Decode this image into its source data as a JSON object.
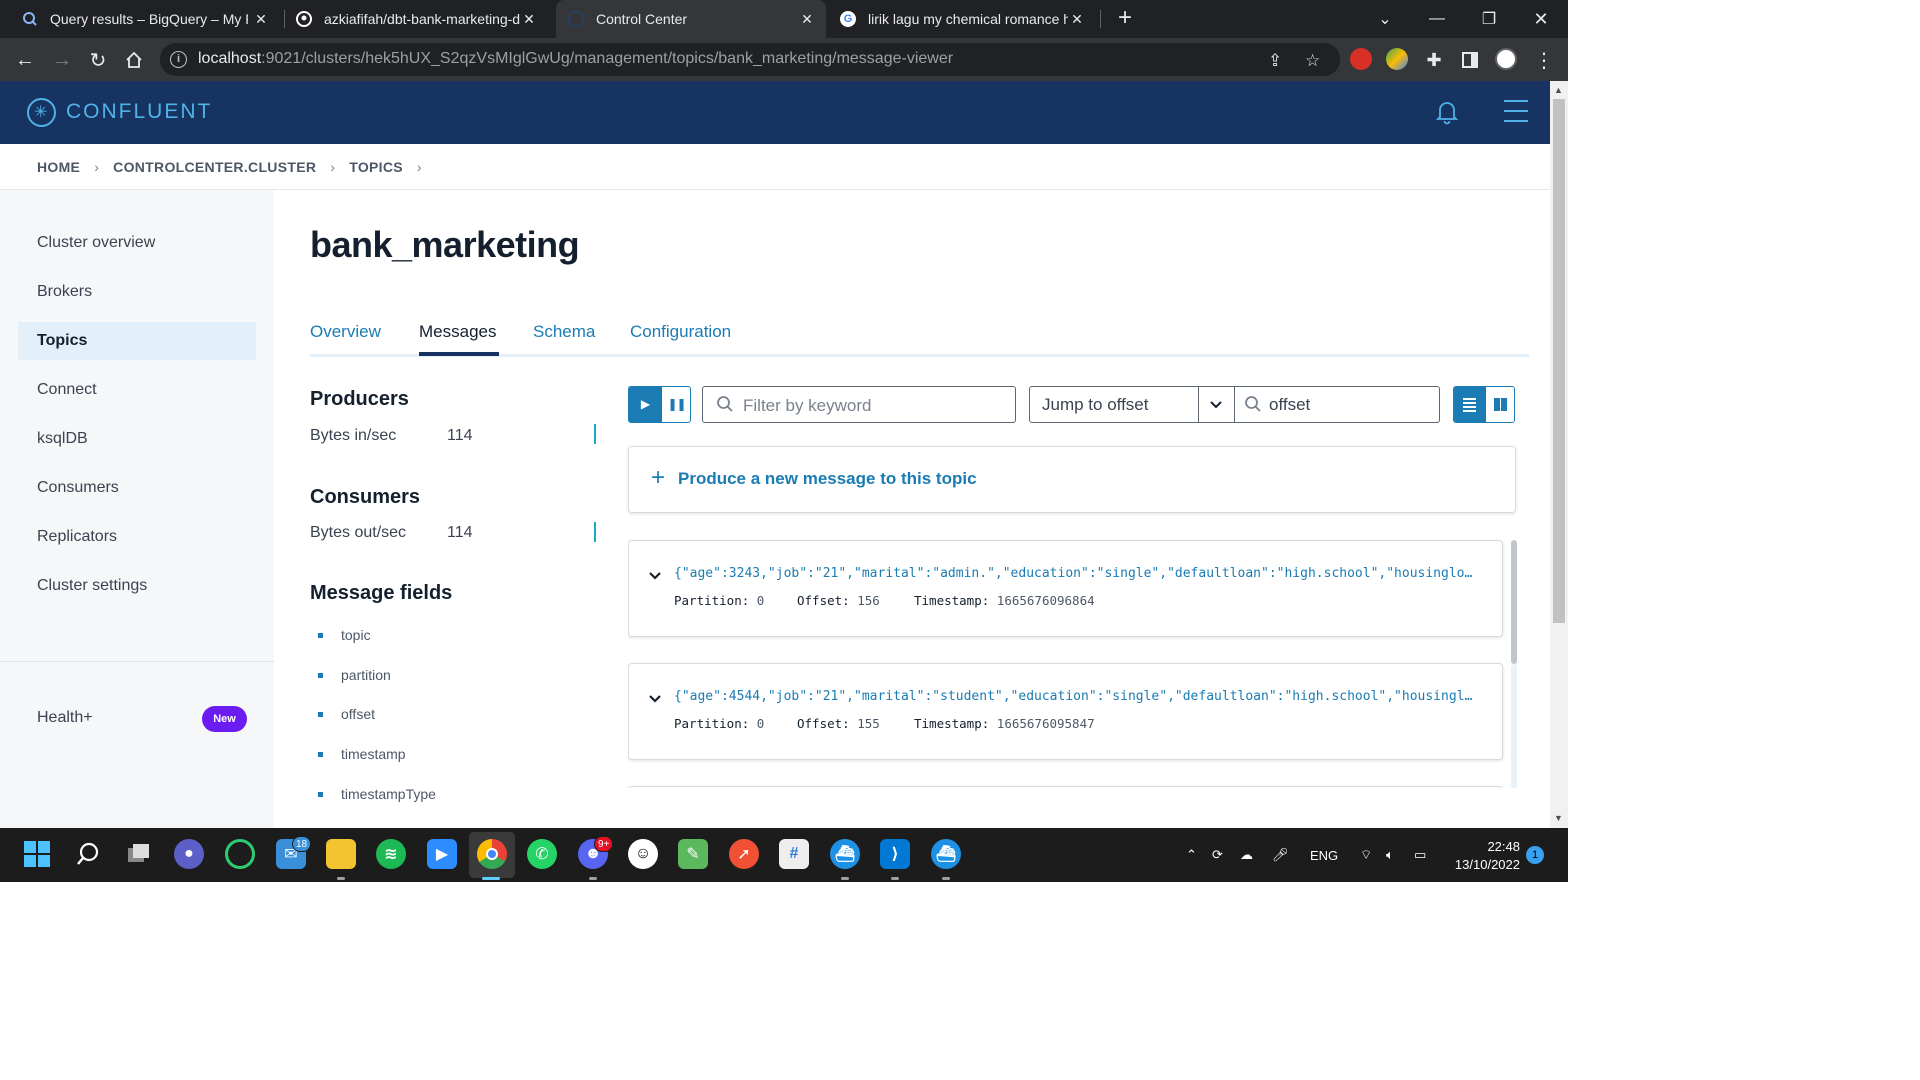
{
  "browser": {
    "tabs": [
      {
        "title": "Query results – BigQuery – My Fi"
      },
      {
        "title": "azkiafifah/dbt-bank-marketing-d"
      },
      {
        "title": "Control Center"
      },
      {
        "title": "lirik lagu my chemical romance h"
      }
    ],
    "url_host": "localhost",
    "url_rest": ":9021/clusters/hek5hUX_S2qzVsMIglGwUg/management/topics/bank_marketing/message-viewer"
  },
  "app": {
    "brand": "CONFLUENT",
    "brand_color": "#173361",
    "accent_color": "#1a7cb3"
  },
  "breadcrumb": [
    "HOME",
    "CONTROLCENTER.CLUSTER",
    "TOPICS"
  ],
  "sidebar": {
    "items": [
      {
        "label": "Cluster overview"
      },
      {
        "label": "Brokers"
      },
      {
        "label": "Topics"
      },
      {
        "label": "Connect"
      },
      {
        "label": "ksqlDB"
      },
      {
        "label": "Consumers"
      },
      {
        "label": "Replicators"
      },
      {
        "label": "Cluster settings"
      }
    ],
    "active": "Topics",
    "health": {
      "label": "Health+",
      "badge": "New"
    }
  },
  "main": {
    "title": "bank_marketing",
    "tabs": [
      {
        "label": "Overview"
      },
      {
        "label": "Messages"
      },
      {
        "label": "Schema"
      },
      {
        "label": "Configuration"
      }
    ],
    "active_tab": "Messages",
    "producers": {
      "heading": "Producers",
      "label": "Bytes in/sec",
      "value": "114"
    },
    "consumers": {
      "heading": "Consumers",
      "label": "Bytes out/sec",
      "value": "114"
    },
    "message_fields": {
      "heading": "Message fields",
      "fields": [
        "topic",
        "partition",
        "offset",
        "timestamp",
        "timestampType"
      ]
    },
    "controls": {
      "filter_placeholder": "Filter by keyword",
      "jump_label": "Jump to offset",
      "offset_placeholder": "offset"
    },
    "produce_label": "Produce a new message to this topic",
    "messages": [
      {
        "json": "{\"age\":3243,\"job\":\"21\",\"marital\":\"admin.\",\"education\":\"single\",\"defaultloan\":\"high.school\",\"housinglo…",
        "partition_label": "Partition:",
        "partition": "0",
        "offset_label": "Offset:",
        "offset": "156",
        "timestamp_label": "Timestamp:",
        "timestamp": "1665676096864"
      },
      {
        "json": "{\"age\":4544,\"job\":\"21\",\"marital\":\"student\",\"education\":\"single\",\"defaultloan\":\"high.school\",\"housingl…",
        "partition_label": "Partition:",
        "partition": "0",
        "offset_label": "Offset:",
        "offset": "155",
        "timestamp_label": "Timestamp:",
        "timestamp": "1665676095847"
      }
    ]
  },
  "taskbar": {
    "mail_badge": "18",
    "discord_badge": "9+",
    "language": "ENG",
    "time": "22:48",
    "date": "13/10/2022",
    "notifications": "1"
  }
}
